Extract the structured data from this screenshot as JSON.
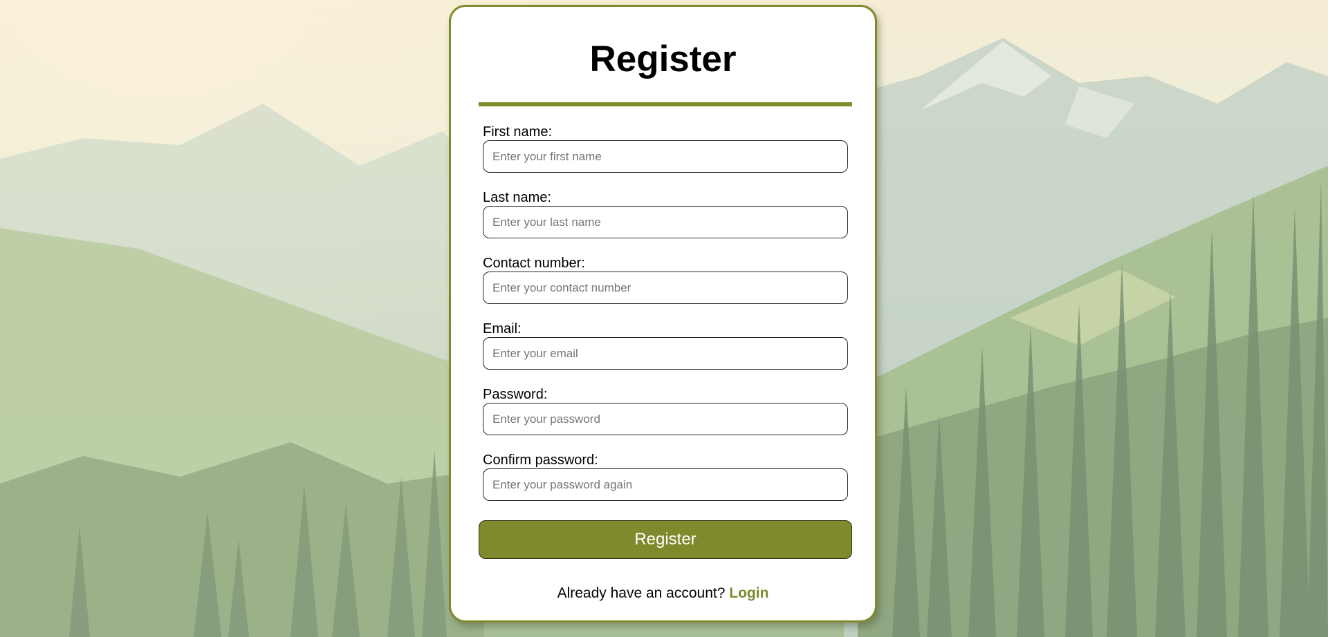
{
  "page": {
    "title": "Register",
    "accent_color": "#7e8a2b"
  },
  "background": {
    "scene": "mountain-forest-landscape"
  },
  "form": {
    "fields": [
      {
        "label": "First name:",
        "placeholder": "Enter your first name",
        "value": ""
      },
      {
        "label": "Last name:",
        "placeholder": "Enter your last name",
        "value": ""
      },
      {
        "label": "Contact number:",
        "placeholder": "Enter your contact number",
        "value": ""
      },
      {
        "label": "Email:",
        "placeholder": "Enter your email",
        "value": ""
      },
      {
        "label": "Password:",
        "placeholder": "Enter your password",
        "value": ""
      },
      {
        "label": "Confirm password:",
        "placeholder": "Enter your password again",
        "value": ""
      }
    ],
    "submit_label": "Register"
  },
  "footer": {
    "prompt": "Already have an account?",
    "link_label": "Login"
  }
}
